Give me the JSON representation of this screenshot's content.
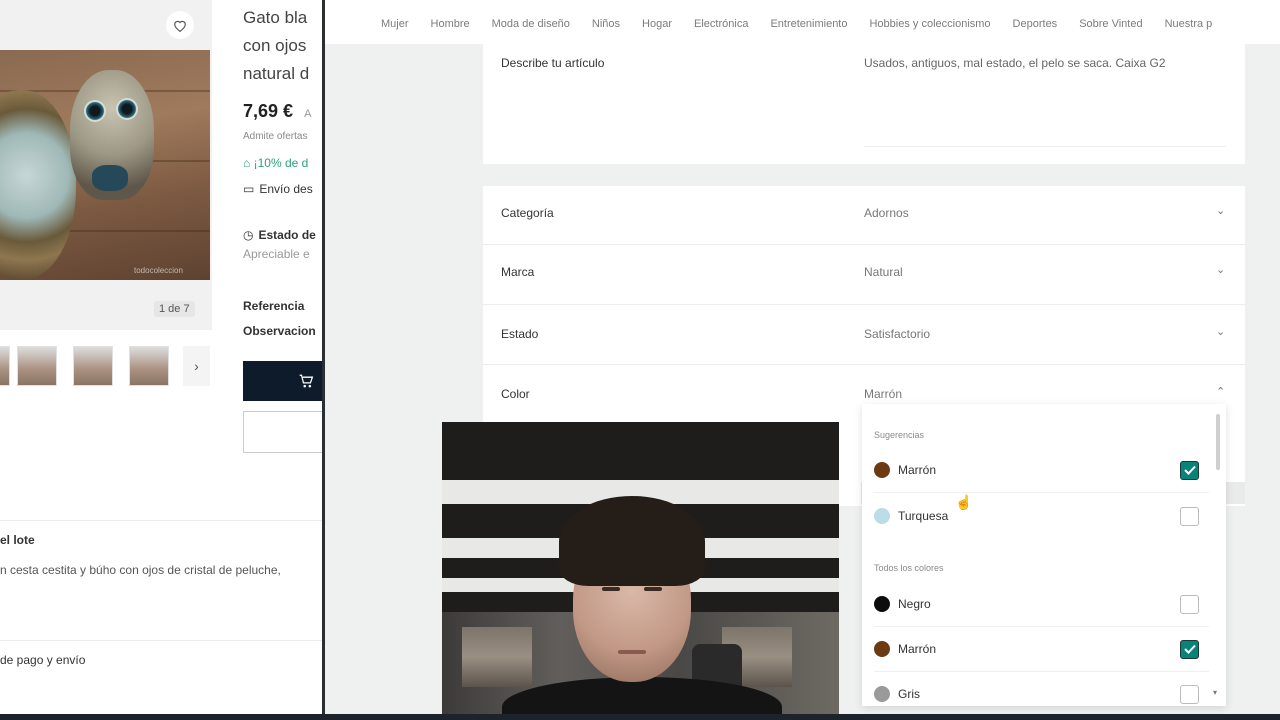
{
  "product": {
    "title": "Gato bla\ncon ojos\nnatural d",
    "price": "7,69 €",
    "price_suffix": "A",
    "offers": "Admite ofertas",
    "discount": "¡10% de d",
    "shipping": "Envío des",
    "condition_label": "Estado de",
    "condition_value": "Apreciable e",
    "reference_label": "Referencia",
    "observations_label": "Observacion",
    "image_counter": "1 de 7",
    "lot_title": "el lote",
    "lot_description": "n cesta cestita y búho con ojos de cristal de peluche,",
    "payment_shipping": "de pago y envío",
    "watermark": "todocoleccion"
  },
  "topnav": {
    "items": [
      "Mujer",
      "Hombre",
      "Moda de diseño",
      "Niños",
      "Hogar",
      "Electrónica",
      "Entretenimiento",
      "Hobbies y coleccionismo",
      "Deportes",
      "Sobre Vinted",
      "Nuestra p"
    ]
  },
  "form": {
    "describe_label": "Describe tu artículo",
    "describe_value": "Usados, antiguos, mal estado, el pelo se saca. Caixa G2",
    "rows": [
      {
        "label": "Categoría",
        "value": "Adornos"
      },
      {
        "label": "Marca",
        "value": "Natural"
      },
      {
        "label": "Estado",
        "value": "Satisfactorio"
      },
      {
        "label": "Color",
        "value": "Marrón"
      }
    ]
  },
  "color_dropdown": {
    "suggestions_label": "Sugerencias",
    "all_colors_label": "Todos los colores",
    "suggestions": [
      {
        "name": "Marrón",
        "color": "#6b3a12",
        "checked": true
      },
      {
        "name": "Turquesa",
        "color": "#bcdce6",
        "checked": false
      }
    ],
    "all": [
      {
        "name": "Negro",
        "color": "#0c0c0c",
        "checked": false
      },
      {
        "name": "Marrón",
        "color": "#6b3a12",
        "checked": true
      },
      {
        "name": "Gris",
        "color": "#9a9a9a",
        "checked": false
      }
    ]
  },
  "colors": {
    "accent": "#09837a",
    "cart_button": "#0d1b2a",
    "discount_text": "#2ca07d"
  }
}
